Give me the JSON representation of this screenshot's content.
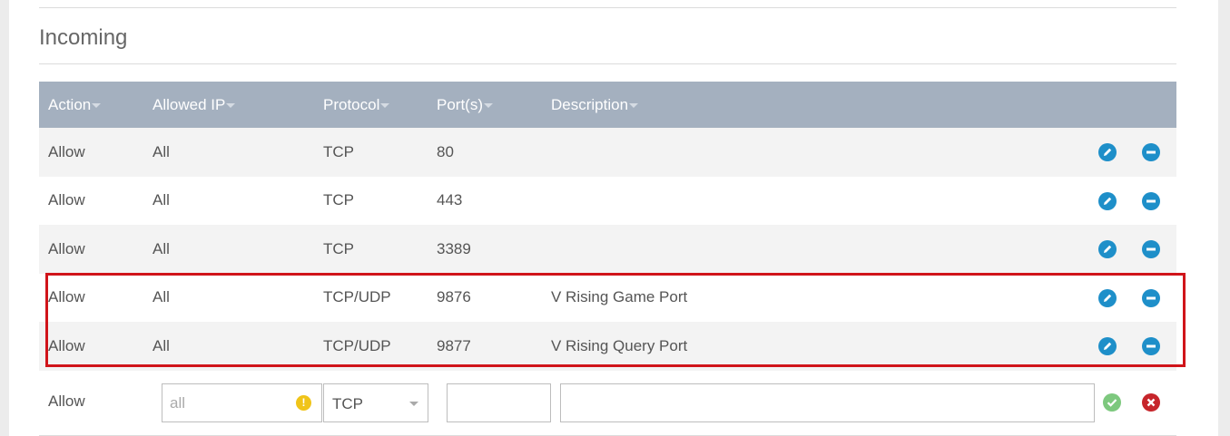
{
  "section": {
    "title": "Incoming"
  },
  "columns": [
    {
      "label": "Action"
    },
    {
      "label": "Allowed IP"
    },
    {
      "label": "Protocol"
    },
    {
      "label": "Port(s)"
    },
    {
      "label": "Description"
    }
  ],
  "rules": [
    {
      "action": "Allow",
      "ip": "All",
      "protocol": "TCP",
      "ports": "80",
      "description": ""
    },
    {
      "action": "Allow",
      "ip": "All",
      "protocol": "TCP",
      "ports": "443",
      "description": ""
    },
    {
      "action": "Allow",
      "ip": "All",
      "protocol": "TCP",
      "ports": "3389",
      "description": ""
    },
    {
      "action": "Allow",
      "ip": "All",
      "protocol": "TCP/UDP",
      "ports": "9876",
      "description": "V Rising Game Port"
    },
    {
      "action": "Allow",
      "ip": "All",
      "protocol": "TCP/UDP",
      "ports": "9877",
      "description": "V Rising Query Port"
    }
  ],
  "new_rule": {
    "action": "Allow",
    "ip_placeholder": "all",
    "warning_glyph": "!",
    "protocol": "TCP",
    "ports_value": "",
    "description_value": ""
  },
  "colors": {
    "header_bg": "#a4b0bf",
    "icon_blue": "#1e8fc9",
    "highlight_red": "#d0141a",
    "confirm_green": "#7dc87e",
    "cancel_red": "#c6252b",
    "warning_yellow": "#f0c419"
  },
  "icons": {
    "edit": "pencil-icon",
    "remove": "minus-circle-icon",
    "confirm": "check-icon",
    "cancel": "close-icon",
    "warning": "warning-icon",
    "sort": "caret-down-icon"
  }
}
